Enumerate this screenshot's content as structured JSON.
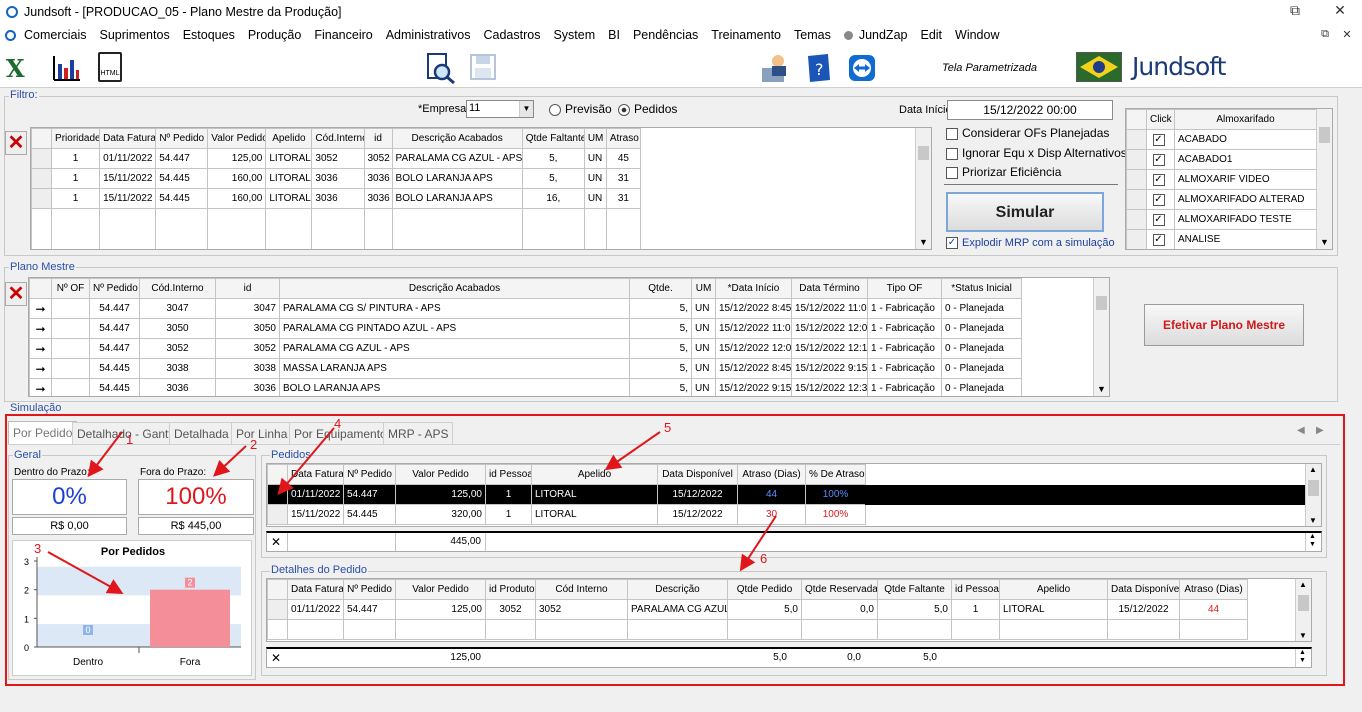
{
  "window": {
    "title": "Jundsoft - [PRODUCAO_05 - Plano Mestre da Produção]",
    "btn_restore": "⧉",
    "btn_close": "✕",
    "child_restore": "⧉",
    "child_close": "✕"
  },
  "menu": [
    "Comerciais",
    "Suprimentos",
    "Estoques",
    "Produção",
    "Financeiro",
    "Administrativos",
    "Cadastros",
    "System",
    "BI",
    "Pendências",
    "Treinamento",
    "Temas",
    "JundZap",
    "Edit",
    "Window"
  ],
  "toolbar": {
    "tela": "Tela Parametrizada",
    "logo": "Jundsoft"
  },
  "filtro": {
    "label": "Filtro:",
    "empresa_label": "*Empresa:",
    "empresa_value": "11",
    "opt_previsao": "Previsão",
    "opt_pedidos": "Pedidos",
    "data_inicio_label": "Data Início:",
    "data_inicio_value": "15/12/2022 00:00",
    "cols": [
      "Prioridade",
      "Data Faturar",
      "Nº Pedido",
      "Valor Pedido",
      "Apelido",
      "Cód.Interno",
      "id",
      "Descrição Acabados",
      "Qtde Faltante",
      "UM",
      "Atraso"
    ],
    "rows": [
      [
        "1",
        "01/11/2022",
        "54.447",
        "125,00",
        "LITORAL",
        "3052",
        "3052",
        "PARALAMA CG AZUL - APS",
        "5,",
        "UN",
        "45"
      ],
      [
        "1",
        "15/11/2022",
        "54.445",
        "160,00",
        "LITORAL",
        "3036",
        "3036",
        "BOLO LARANJA APS",
        "5,",
        "UN",
        "31"
      ],
      [
        "1",
        "15/11/2022",
        "54.445",
        "160,00",
        "LITORAL",
        "3036",
        "3036",
        "BOLO LARANJA APS",
        "16,",
        "UN",
        "31"
      ]
    ],
    "opt1": "Considerar OFs Planejadas",
    "opt2": "Ignorar Equ x Disp Alternativos",
    "opt3": "Priorizar Eficiência",
    "simular": "Simular",
    "explodir": "Explodir MRP com a simulação",
    "alm_cols": [
      "Click",
      "Almoxarifado"
    ],
    "almox": [
      "ACABADO",
      "ACABADO1",
      "ALMOXARIF VIDEO",
      "ALMOXARIFADO ALTERAD",
      "ALMOXARIFADO TESTE",
      "ANALISE"
    ]
  },
  "plano": {
    "label": "Plano Mestre",
    "cols": [
      "Nº OF",
      "Nº Pedido",
      "Cód.Interno",
      "id",
      "Descrição Acabados",
      "Qtde.",
      "UM",
      "*Data Início",
      "Data Término",
      "Tipo OF",
      "*Status Inicial"
    ],
    "rows": [
      [
        "",
        "54.447",
        "3047",
        "3047",
        "PARALAMA CG S/ PINTURA - APS",
        "5,",
        "UN",
        "15/12/2022 8:45",
        "15/12/2022 11:06",
        "1 - Fabricação",
        "0 - Planejada"
      ],
      [
        "",
        "54.447",
        "3050",
        "3050",
        "PARALAMA CG PINTADO AZUL - APS",
        "5,",
        "UN",
        "15/12/2022 11:06",
        "15/12/2022 12:01",
        "1 - Fabricação",
        "0 - Planejada"
      ],
      [
        "",
        "54.447",
        "3052",
        "3052",
        "PARALAMA CG AZUL - APS",
        "5,",
        "UN",
        "15/12/2022 12:01",
        "15/12/2022 12:19",
        "1 - Fabricação",
        "0 - Planejada"
      ],
      [
        "",
        "54.445",
        "3038",
        "3038",
        "MASSA LARANJA APS",
        "5,",
        "UN",
        "15/12/2022 8:45",
        "15/12/2022 9:15",
        "1 - Fabricação",
        "0 - Planejada"
      ],
      [
        "",
        "54.445",
        "3036",
        "3036",
        "BOLO LARANJA APS",
        "5,",
        "UN",
        "15/12/2022 9:15",
        "15/12/2022 12:34",
        "1 - Fabricação",
        "0 - Planejada"
      ]
    ],
    "efetivar": "Efetivar Plano Mestre"
  },
  "simulacao": {
    "label": "Simulação",
    "tabs": [
      "Por Pedido",
      "Detalhado - Gantt",
      "Detalhada",
      "Por Linha",
      "Por Equipamento",
      "MRP - APS"
    ],
    "geral": "Geral",
    "dentro_label": "Dentro do Prazo:",
    "dentro_pct": "0%",
    "dentro_val": "R$ 0,00",
    "fora_label": "Fora do Prazo:",
    "fora_pct": "100%",
    "fora_val": "R$ 445,00",
    "chart_title": "Por Pedidos",
    "pedidos_label": "Pedidos",
    "ped_cols": [
      "Data Faturar",
      "Nº Pedido",
      "Valor Pedido",
      "id Pessoa",
      "Apelido",
      "Data Disponível",
      "Atraso (Dias)",
      "% De Atraso"
    ],
    "ped_rows": [
      [
        "01/11/2022",
        "54.447",
        "125,00",
        "1",
        "LITORAL",
        "15/12/2022",
        "44",
        "100%"
      ],
      [
        "15/11/2022",
        "54.445",
        "320,00",
        "1",
        "LITORAL",
        "15/12/2022",
        "30",
        "100%"
      ]
    ],
    "ped_total": "445,00",
    "det_label": "Detalhes do Pedido",
    "det_cols": [
      "Data Faturar",
      "Nº Pedido",
      "Valor Pedido",
      "id Produto",
      "Cód Interno",
      "Descrição",
      "Qtde Pedido",
      "Qtde Reservada",
      "Qtde Faltante",
      "id Pessoa",
      "Apelido",
      "Data Disponível",
      "Atraso (Dias)"
    ],
    "det_rows": [
      [
        "01/11/2022",
        "54.447",
        "125,00",
        "3052",
        "3052",
        "PARALAMA CG AZUL",
        "5,0",
        "0,0",
        "5,0",
        "1",
        "LITORAL",
        "15/12/2022",
        "44"
      ]
    ],
    "det_total": [
      "125,00",
      "5,0",
      "0,0",
      "5,0"
    ],
    "annotations": [
      "1",
      "2",
      "3",
      "4",
      "5",
      "6"
    ]
  },
  "chart_data": {
    "type": "bar",
    "title": "Por Pedidos",
    "categories": [
      "Dentro",
      "Fora"
    ],
    "values": [
      0,
      2
    ],
    "ylim": [
      0,
      3
    ],
    "yticks": [
      "0",
      "1",
      "2",
      "3"
    ],
    "colors": {
      "Dentro": "#8fb4e8",
      "Fora": "#f48f9a"
    }
  }
}
